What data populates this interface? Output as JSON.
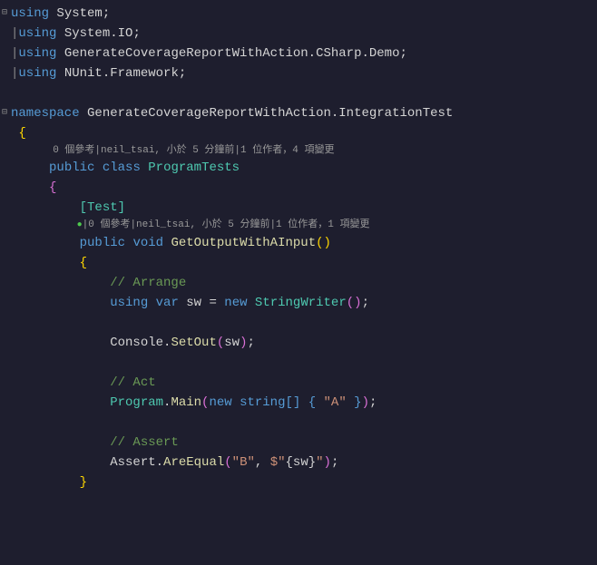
{
  "usings": {
    "u1": "using",
    "u1ns": "System",
    "u2": "using",
    "u2ns": "System.IO",
    "u3": "using",
    "u3ns": "GenerateCoverageReportWithAction.CSharp.Demo",
    "u4": "using",
    "u4ns": "NUnit.Framework"
  },
  "ns": {
    "kw": "namespace",
    "name": "GenerateCoverageReportWithAction.IntegrationTest"
  },
  "codelens1": "0 個參考|neil_tsai, 小於 5 分鐘前|1 位作者，4 項變更",
  "class": {
    "mod": "public",
    "kw": "class",
    "name": "ProgramTests"
  },
  "attr": "[Test]",
  "codelens2": "|0 個參考|neil_tsai, 小於 5 分鐘前|1 位作者，1 項變更",
  "method": {
    "mod": "public",
    "ret": "void",
    "name": "GetOutputWithAInput"
  },
  "body": {
    "c1": "// Arrange",
    "l1a": "using",
    "l1b": "var",
    "l1c": "sw",
    "l1d": "=",
    "l1e": "new",
    "l1f": "StringWriter",
    "l2a": "Console",
    "l2b": "SetOut",
    "l2c": "sw",
    "c2": "// Act",
    "l3a": "Program",
    "l3b": "Main",
    "l3c": "new",
    "l3d": "string",
    "l3e": "\"A\"",
    "c3": "// Assert",
    "l4a": "Assert",
    "l4b": "AreEqual",
    "l4c": "\"B\"",
    "l4d": "$\"",
    "l4e": "{",
    "l4f": "sw",
    "l4g": "}",
    "l4h": "\""
  }
}
